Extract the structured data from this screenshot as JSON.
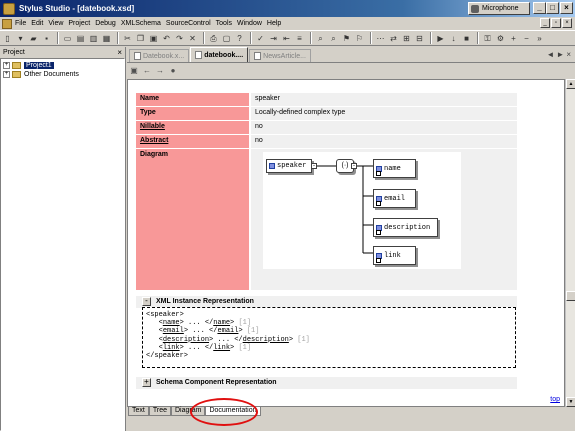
{
  "window": {
    "title": "Stylus Studio - [datebook.xsd]",
    "microphone_label": "Microphone",
    "minimize": "_",
    "maximize": "□",
    "close": "×"
  },
  "menu": {
    "items": [
      "File",
      "Edit",
      "View",
      "Project",
      "Debug",
      "XMLSchema",
      "SourceControl",
      "Tools",
      "Window",
      "Help"
    ]
  },
  "project_pane": {
    "title": "Project",
    "close": "×",
    "tree": [
      {
        "label": "Project1",
        "toggle": "+",
        "selected": true
      },
      {
        "label": "Other Documents",
        "toggle": "+",
        "selected": false
      }
    ]
  },
  "doc_tabs": [
    {
      "label": "Datebook.x...",
      "active": false
    },
    {
      "label": "datebook....",
      "active": true
    },
    {
      "label": "NewsArticle...",
      "active": false
    }
  ],
  "nav_arrows": {
    "left": "◄",
    "right": "►",
    "close": "×"
  },
  "doc_toolbar": {
    "back": "←",
    "forward": "→",
    "stop": "●"
  },
  "properties": [
    {
      "key": "Name",
      "value": "speaker",
      "link": false
    },
    {
      "key": "Type",
      "value": "Locally-defined complex type",
      "link": false
    },
    {
      "key": "Nillable",
      "value": "no",
      "link": true
    },
    {
      "key": "Abstract",
      "value": "no",
      "link": true
    }
  ],
  "diagram": {
    "label": "Diagram",
    "root": "speaker",
    "sequence": "(·)",
    "children": [
      "name",
      "email",
      "description",
      "link"
    ]
  },
  "xml_instance": {
    "toggle": "-",
    "title": "XML Instance Representation",
    "lines": [
      {
        "indent": "",
        "open": "<speaker>",
        "name": "",
        "mid": "",
        "close_name": "",
        "end": "",
        "count": ""
      },
      {
        "indent": "   ",
        "open": "<",
        "name": "name",
        "mid": "> ... </",
        "close_name": "name",
        "end": ">",
        "count": " [1]"
      },
      {
        "indent": "   ",
        "open": "<",
        "name": "email",
        "mid": "> ... </",
        "close_name": "email",
        "end": ">",
        "count": " [1]"
      },
      {
        "indent": "   ",
        "open": "<",
        "name": "description",
        "mid": "> ... </",
        "close_name": "description",
        "end": ">",
        "count": " [1]"
      },
      {
        "indent": "   ",
        "open": "<",
        "name": "link",
        "mid": "> ... </",
        "close_name": "link",
        "end": ">",
        "count": " [1]"
      },
      {
        "indent": "",
        "open": "</speaker>",
        "name": "",
        "mid": "",
        "close_name": "",
        "end": "",
        "count": ""
      }
    ]
  },
  "schema_component": {
    "toggle": "+",
    "title": "Schema Component Representation"
  },
  "top_link": "top",
  "bottom_tabs": [
    {
      "label": "Text",
      "active": false
    },
    {
      "label": "Tree",
      "active": false
    },
    {
      "label": "Diagram",
      "active": false
    },
    {
      "label": "Documentation",
      "active": true
    }
  ],
  "colors": {
    "title_bar": "#0a246a",
    "property_key_bg": "#f89898",
    "highlight_ellipse": "#e01010",
    "link": "#0000e0"
  }
}
